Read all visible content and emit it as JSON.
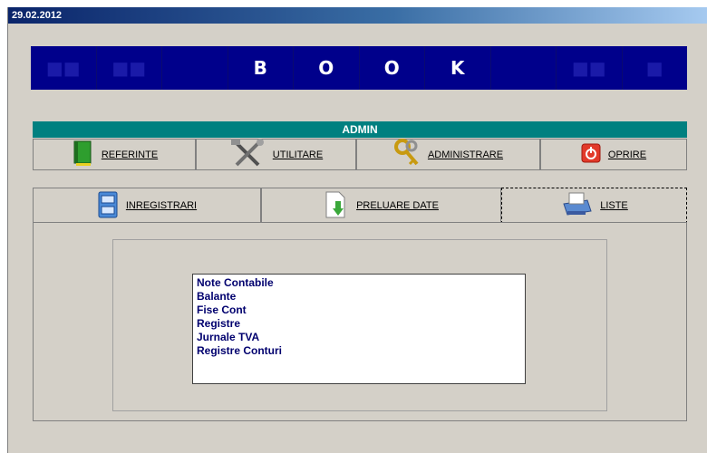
{
  "window": {
    "title": "29.02.2012"
  },
  "banner": {
    "letters": [
      "",
      "",
      "",
      "B",
      "O",
      "O",
      "K",
      "",
      "",
      ""
    ]
  },
  "section": {
    "title": "ADMIN"
  },
  "tabs_row1": [
    {
      "label": "REFERINTE",
      "icon": "green-book-icon"
    },
    {
      "label": "UTILITARE",
      "icon": "tools-icon"
    },
    {
      "label": "ADMINISTRARE",
      "icon": "keys-icon"
    },
    {
      "label": "OPRIRE",
      "icon": "power-icon"
    }
  ],
  "tabs_row2": [
    {
      "label": "INREGISTRARI",
      "icon": "filing-cabinet-icon"
    },
    {
      "label": "PRELUARE DATE",
      "icon": "download-document-icon"
    },
    {
      "label": "LISTE",
      "icon": "printer-icon",
      "selected": true
    }
  ],
  "list": {
    "items": [
      "Note Contabile",
      "Balante",
      "Fise Cont",
      "Registre",
      "Jurnale TVA",
      "Registre Conturi"
    ]
  },
  "colors": {
    "banner": "#00008b",
    "admin_bar": "#008080",
    "list_text": "#00006e"
  }
}
